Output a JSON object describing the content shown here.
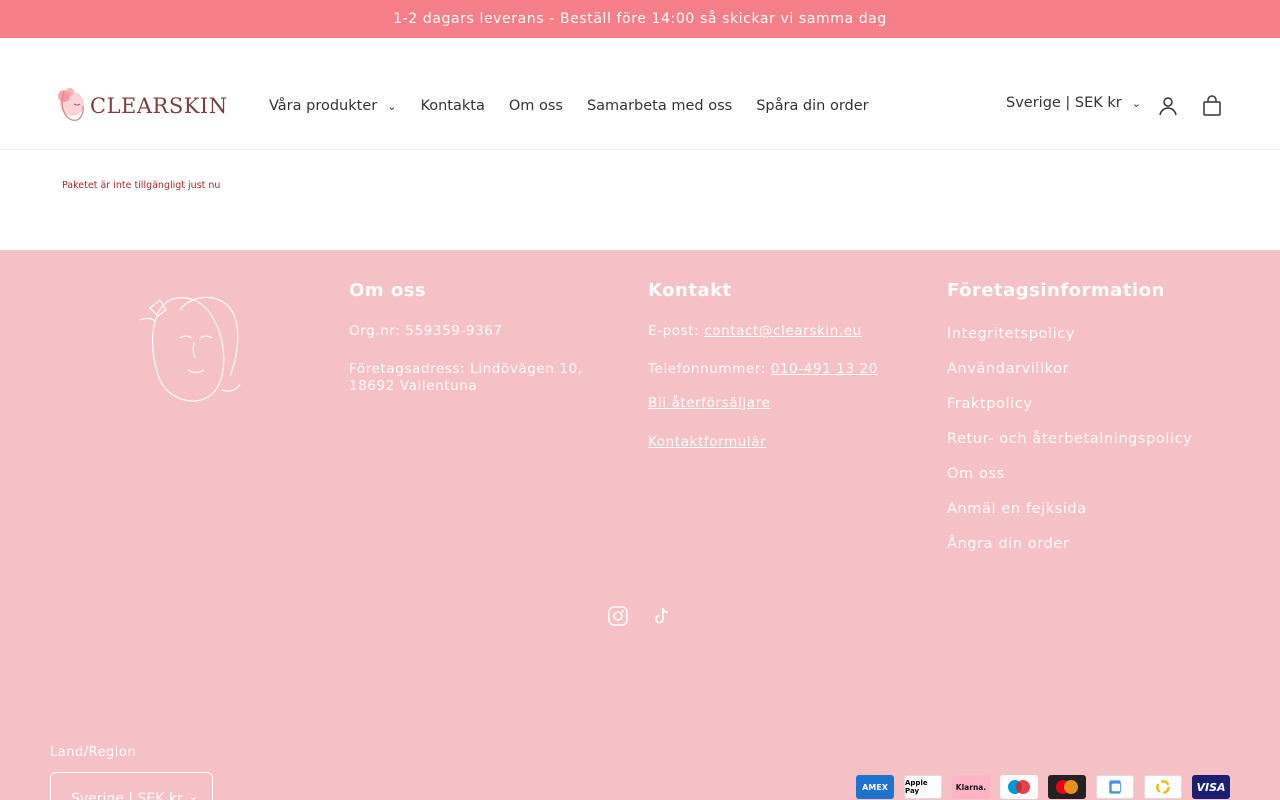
{
  "announcement": "1-2 dagars leverans - Beställ före 14:00 så skickar vi samma dag",
  "brand": {
    "name": "CLEARSKIN",
    "accent": "#f47f88",
    "footer_bg": "#f5c1c4"
  },
  "nav": {
    "items": [
      "Våra produkter",
      "Kontakta",
      "Om oss",
      "Samarbeta med oss",
      "Spåra din order"
    ]
  },
  "header": {
    "country_selector": "Sverige | SEK kr",
    "account_icon": "user-icon",
    "cart_icon": "bag-icon"
  },
  "notice": "Paketet är inte tillgängligt just nu",
  "footer": {
    "about": {
      "heading": "Om oss",
      "org": "Org.nr: 559359-9367",
      "address": "Företagsadress: Lindövägen 10, 18692 Vallentuna"
    },
    "contact": {
      "heading": "Kontakt",
      "email_label": "E-post: ",
      "email": "contact@clearskin.eu",
      "phone_label": "Telefonnummer: ",
      "phone": "010-491 13 20",
      "reseller": "Bli återförsäljare",
      "form": "Kontaktformulär"
    },
    "company": {
      "heading": "Företagsinformation",
      "links": [
        "Integritetspolicy",
        "Användarvillkor",
        "Fraktpolicy",
        "Retur- och återbetalningspolicy",
        "Om oss",
        "Anmäl en fejksida",
        "Ångra din order"
      ]
    },
    "social": [
      "Instagram",
      "TikTok"
    ],
    "region": {
      "label": "Land/Region",
      "value": "Sverige | SEK kr"
    },
    "payments": [
      "AMEX",
      "Apple Pay",
      "Klarna.",
      "Maestro",
      "Mastercard",
      "Swish",
      "Trustly",
      "VISA"
    ]
  }
}
